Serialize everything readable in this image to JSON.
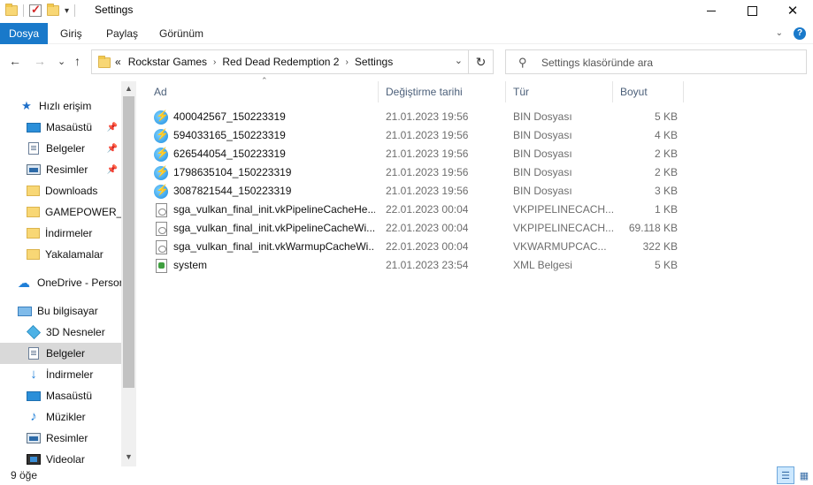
{
  "window": {
    "title": "Settings",
    "qa_dropdown": "▾",
    "controls": {
      "minimize": "",
      "maximize": "",
      "close": "✕"
    }
  },
  "ribbon": {
    "tabs": [
      "Dosya",
      "Giriş",
      "Paylaş",
      "Görünüm"
    ],
    "active_tab": "Dosya",
    "collapse_icon": "⌄",
    "help_label": "?"
  },
  "nav": {
    "back": "←",
    "forward": "→",
    "recent": "⌄",
    "up": "↑",
    "overflow": "«",
    "breadcrumb": [
      "Rockstar Games",
      "Red Dead Redemption 2",
      "Settings"
    ],
    "separator": "›",
    "dropdown": "⌄",
    "refresh": "↻"
  },
  "search": {
    "icon": "⚲",
    "placeholder": "Settings klasöründe ara"
  },
  "sidebar": {
    "scroll_up": "▲",
    "scroll_down": "▼",
    "pin_icon": "📌",
    "items": [
      {
        "label": "Hızlı erişim",
        "icon": "star-icon",
        "glyph": "★"
      },
      {
        "label": "Masaüstü",
        "icon": "desktop-icon",
        "pinned": true
      },
      {
        "label": "Belgeler",
        "icon": "documents-icon",
        "pinned": true
      },
      {
        "label": "Resimler",
        "icon": "pictures-icon",
        "pinned": true
      },
      {
        "label": "Downloads",
        "icon": "folder-icon"
      },
      {
        "label": "GAMEPOWER_V",
        "icon": "folder-icon"
      },
      {
        "label": "İndirmeler",
        "icon": "folder-icon"
      },
      {
        "label": "Yakalamalar",
        "icon": "folder-icon"
      },
      {
        "label": "OneDrive - Persor",
        "icon": "cloud-icon",
        "glyph": "☁"
      },
      {
        "label": "Bu bilgisayar",
        "icon": "computer-icon"
      },
      {
        "label": "3D Nesneler",
        "icon": "3d-objects-icon"
      },
      {
        "label": "Belgeler",
        "icon": "documents-icon"
      },
      {
        "label": "İndirmeler",
        "icon": "download-icon",
        "glyph": "↓"
      },
      {
        "label": "Masaüstü",
        "icon": "desktop-icon"
      },
      {
        "label": "Müzikler",
        "icon": "music-icon",
        "glyph": "♪"
      },
      {
        "label": "Resimler",
        "icon": "pictures-icon"
      },
      {
        "label": "Videolar",
        "icon": "videos-icon"
      }
    ]
  },
  "list": {
    "sort_indicator": "⌃",
    "columns": [
      "Ad",
      "Değiştirme tarihi",
      "Tür",
      "Boyut"
    ],
    "files": [
      {
        "name": "400042567_150223319",
        "date": "21.01.2023 19:56",
        "type": "BIN Dosyası",
        "size": "5 KB",
        "icon": "bin-file-icon"
      },
      {
        "name": "594033165_150223319",
        "date": "21.01.2023 19:56",
        "type": "BIN Dosyası",
        "size": "4 KB",
        "icon": "bin-file-icon"
      },
      {
        "name": "626544054_150223319",
        "date": "21.01.2023 19:56",
        "type": "BIN Dosyası",
        "size": "2 KB",
        "icon": "bin-file-icon"
      },
      {
        "name": "1798635104_150223319",
        "date": "21.01.2023 19:56",
        "type": "BIN Dosyası",
        "size": "2 KB",
        "icon": "bin-file-icon"
      },
      {
        "name": "3087821544_150223319",
        "date": "21.01.2023 19:56",
        "type": "BIN Dosyası",
        "size": "3 KB",
        "icon": "bin-file-icon"
      },
      {
        "name": "sga_vulkan_final_init.vkPipelineCacheHe...",
        "date": "22.01.2023 00:04",
        "type": "VKPIPELINECACH...",
        "size": "1 KB",
        "icon": "generic-file-icon"
      },
      {
        "name": "sga_vulkan_final_init.vkPipelineCacheWi...",
        "date": "22.01.2023 00:04",
        "type": "VKPIPELINECACH...",
        "size": "69.118 KB",
        "icon": "generic-file-icon"
      },
      {
        "name": "sga_vulkan_final_init.vkWarmupCacheWi...",
        "date": "22.01.2023 00:04",
        "type": "VKWARMUPCAC...",
        "size": "322 KB",
        "icon": "generic-file-icon"
      },
      {
        "name": "system",
        "date": "21.01.2023 23:54",
        "type": "XML Belgesi",
        "size": "5 KB",
        "icon": "xml-file-icon"
      }
    ]
  },
  "status": {
    "item_count": "9 öğe",
    "details_view_icon": "☰",
    "tiles_view_icon": "▦"
  },
  "colors": {
    "accent": "#1979ca",
    "selection": "#cce8ff",
    "header_text": "#4c607a"
  }
}
